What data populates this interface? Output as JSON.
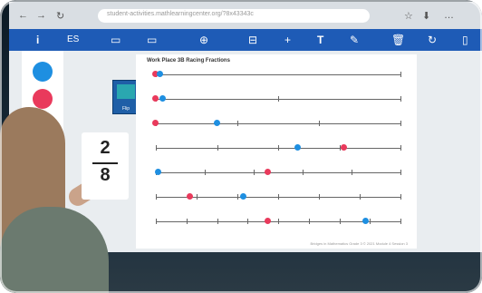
{
  "browser": {
    "nav_back": "←",
    "nav_forward": "→",
    "reload": "↻",
    "url": "student-activities.mathlearningcenter.org/?8x43343c",
    "star": "☆",
    "download": "⬇",
    "tab_label": "…"
  },
  "toolbar": {
    "info": "i",
    "es": "ES",
    "panel": "▭",
    "screen": "▭",
    "zoom": "⊕",
    "tool": "⊟",
    "add": "+",
    "text": "T",
    "pen": "✎",
    "trash": "🗑",
    "refresh": "↻",
    "page": "▯"
  },
  "worksheet": {
    "title": "Work Place 3B Racing Fractions",
    "icon_label": "Flip",
    "footer": "Bridges in Mathematics Grade 3 © 2021 Module 4 Session 3"
  },
  "card": {
    "numerator": "2",
    "denominator": "8"
  },
  "colors": {
    "blue": "#1e8fe1",
    "red": "#e93a5c",
    "toolbar": "#1e5bb6"
  }
}
